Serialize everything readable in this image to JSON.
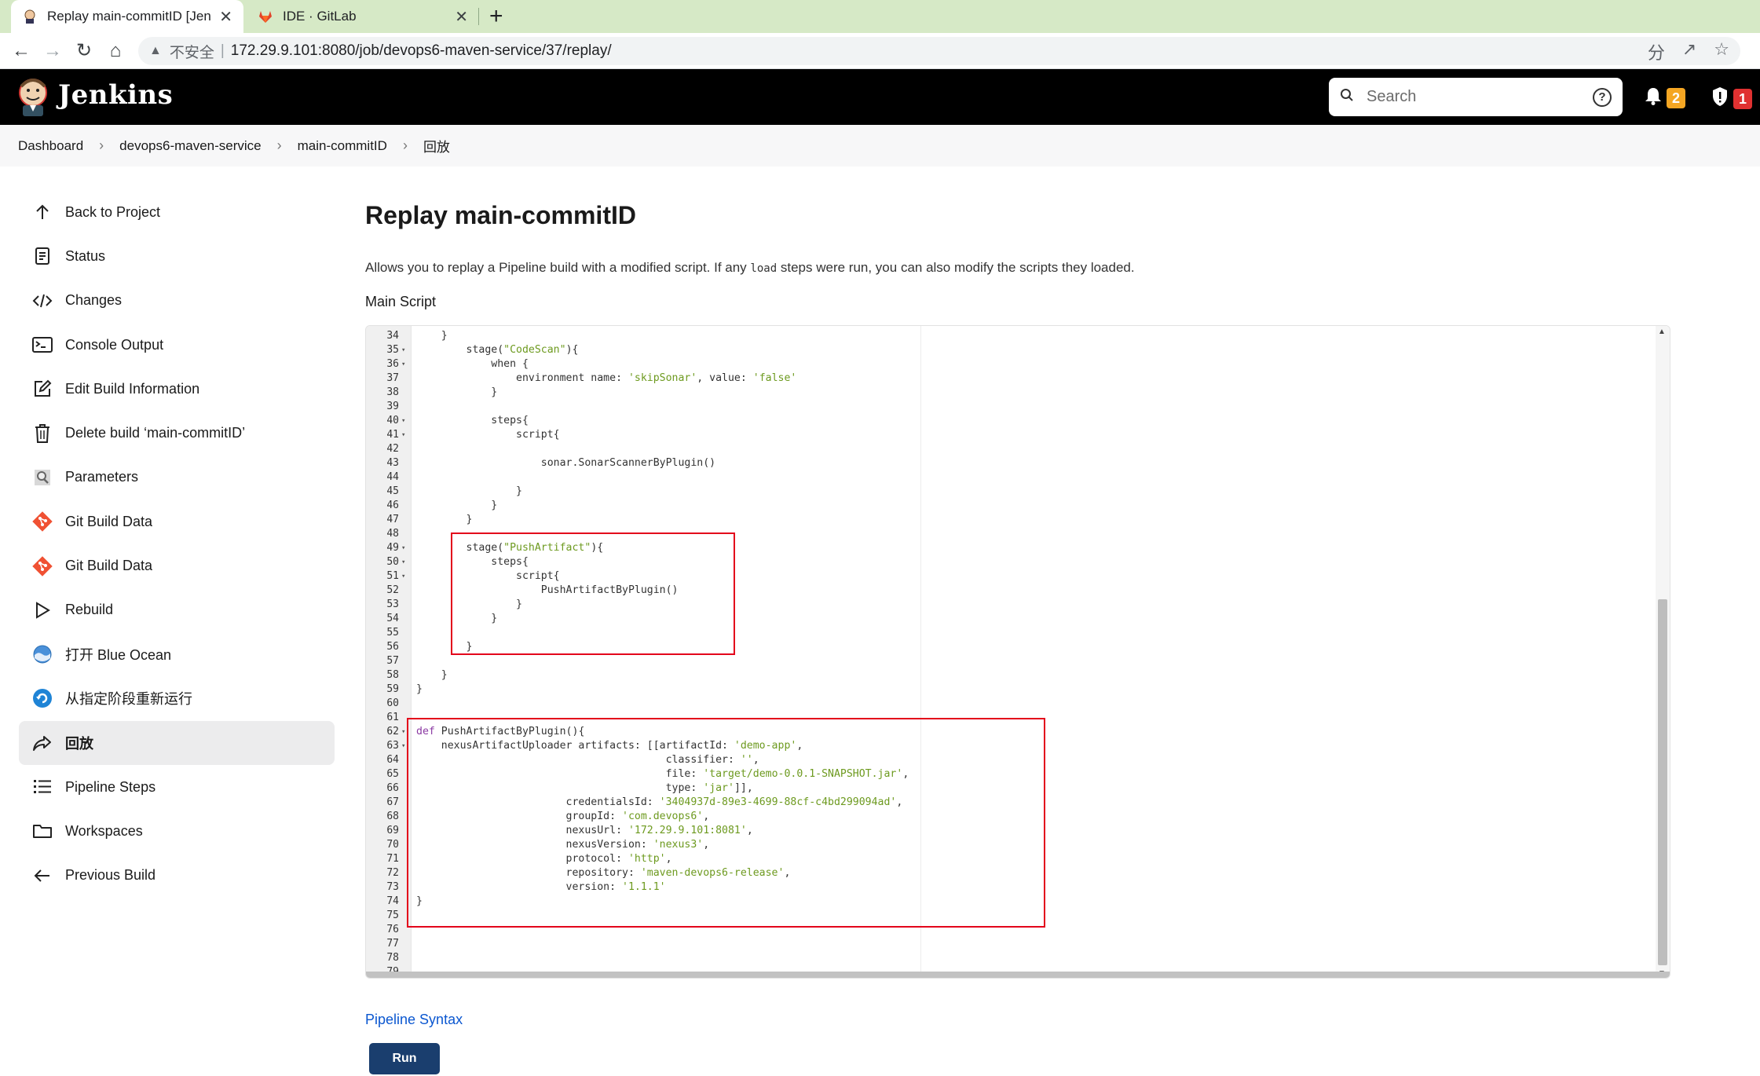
{
  "browser": {
    "tabs": [
      {
        "title": "Replay main-commitID [Jenkins]",
        "active": true,
        "close": "✕"
      },
      {
        "title": "IDE · GitLab",
        "active": false,
        "close": "✕"
      }
    ],
    "new_tab": "+",
    "security_label": "不安全",
    "url": "172.29.9.101:8080/job/devops6-maven-service/37/replay/"
  },
  "header": {
    "title": "Jenkins",
    "search_placeholder": "Search",
    "notification_count": "2",
    "security_count": "1",
    "notification_color": "#f5a623",
    "security_color": "#e03131"
  },
  "breadcrumb": [
    "Dashboard",
    "devops6-maven-service",
    "main-commitID",
    "回放"
  ],
  "sidebar": {
    "items": [
      {
        "label": "Back to Project",
        "icon": "arrow-up-icon"
      },
      {
        "label": "Status",
        "icon": "document-icon"
      },
      {
        "label": "Changes",
        "icon": "code-icon"
      },
      {
        "label": "Console Output",
        "icon": "terminal-icon"
      },
      {
        "label": "Edit Build Information",
        "icon": "edit-icon"
      },
      {
        "label": "Delete build ‘main-commitID’",
        "icon": "trash-icon"
      },
      {
        "label": "Parameters",
        "icon": "parameters-icon"
      },
      {
        "label": "Git Build Data",
        "icon": "git-icon"
      },
      {
        "label": "Git Build Data",
        "icon": "git-icon"
      },
      {
        "label": "Rebuild",
        "icon": "play-icon"
      },
      {
        "label": "打开 Blue Ocean",
        "icon": "blue-ocean-icon"
      },
      {
        "label": "从指定阶段重新运行",
        "icon": "restart-icon"
      },
      {
        "label": "回放",
        "icon": "replay-icon",
        "active": true
      },
      {
        "label": "Pipeline Steps",
        "icon": "list-icon"
      },
      {
        "label": "Workspaces",
        "icon": "folder-icon"
      },
      {
        "label": "Previous Build",
        "icon": "arrow-left-icon"
      }
    ]
  },
  "main": {
    "title": "Replay main-commitID",
    "description_before": "Allows you to replay a Pipeline build with a modified script. If any ",
    "description_code": "load",
    "description_after": " steps were run, you can also modify the scripts they loaded.",
    "section_label": "Main Script",
    "pipeline_syntax_link": "Pipeline Syntax",
    "run_button": "Run"
  },
  "editor": {
    "lines": [
      {
        "n": "34",
        "text": "    }"
      },
      {
        "n": "35",
        "fold": true,
        "text": "        stage(\"CodeScan\"){"
      },
      {
        "n": "36",
        "fold": true,
        "text": "            when {"
      },
      {
        "n": "37",
        "text": "                environment name: 'skipSonar', value: 'false'"
      },
      {
        "n": "38",
        "text": "            }"
      },
      {
        "n": "39",
        "text": ""
      },
      {
        "n": "40",
        "fold": true,
        "text": "            steps{"
      },
      {
        "n": "41",
        "fold": true,
        "text": "                script{"
      },
      {
        "n": "42",
        "text": ""
      },
      {
        "n": "43",
        "text": "                    sonar.SonarScannerByPlugin()"
      },
      {
        "n": "44",
        "text": ""
      },
      {
        "n": "45",
        "text": "                }"
      },
      {
        "n": "46",
        "text": "            }"
      },
      {
        "n": "47",
        "text": "        }"
      },
      {
        "n": "48",
        "text": ""
      },
      {
        "n": "49",
        "fold": true,
        "text": "        stage(\"PushArtifact\"){"
      },
      {
        "n": "50",
        "fold": true,
        "text": "            steps{"
      },
      {
        "n": "51",
        "fold": true,
        "text": "                script{"
      },
      {
        "n": "52",
        "text": "                    PushArtifactByPlugin()"
      },
      {
        "n": "53",
        "text": "                }"
      },
      {
        "n": "54",
        "text": "            }"
      },
      {
        "n": "55",
        "text": ""
      },
      {
        "n": "56",
        "text": "        }"
      },
      {
        "n": "57",
        "text": ""
      },
      {
        "n": "58",
        "text": "    }"
      },
      {
        "n": "59",
        "text": "}"
      },
      {
        "n": "60",
        "text": ""
      },
      {
        "n": "61",
        "text": ""
      },
      {
        "n": "62",
        "fold": true,
        "text": "def PushArtifactByPlugin(){"
      },
      {
        "n": "63",
        "fold": true,
        "text": "    nexusArtifactUploader artifacts: [[artifactId: 'demo-app',"
      },
      {
        "n": "64",
        "text": "                                        classifier: '',"
      },
      {
        "n": "65",
        "text": "                                        file: 'target/demo-0.0.1-SNAPSHOT.jar',"
      },
      {
        "n": "66",
        "text": "                                        type: 'jar']],"
      },
      {
        "n": "67",
        "text": "                        credentialsId: '3404937d-89e3-4699-88cf-c4bd299094ad',"
      },
      {
        "n": "68",
        "text": "                        groupId: 'com.devops6',"
      },
      {
        "n": "69",
        "text": "                        nexusUrl: '172.29.9.101:8081',"
      },
      {
        "n": "70",
        "text": "                        nexusVersion: 'nexus3',"
      },
      {
        "n": "71",
        "text": "                        protocol: 'http',"
      },
      {
        "n": "72",
        "text": "                        repository: 'maven-devops6-release',"
      },
      {
        "n": "73",
        "text": "                        version: '1.1.1'"
      },
      {
        "n": "74",
        "text": "}"
      },
      {
        "n": "75",
        "text": ""
      },
      {
        "n": "76",
        "text": ""
      },
      {
        "n": "77",
        "text": ""
      },
      {
        "n": "78",
        "text": ""
      },
      {
        "n": "79",
        "text": ""
      }
    ]
  }
}
